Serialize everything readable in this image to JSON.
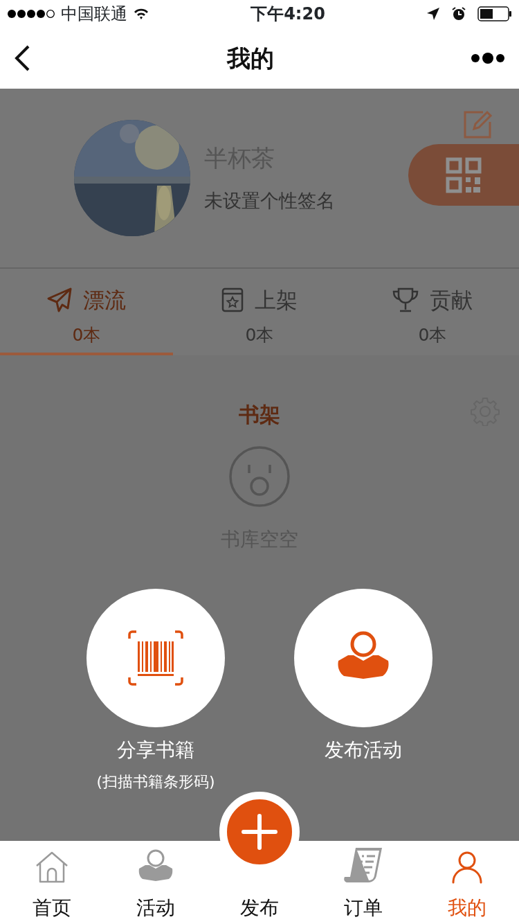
{
  "status_bar": {
    "carrier": "中国联通",
    "time": "下午4:20"
  },
  "nav": {
    "title": "我的"
  },
  "profile": {
    "name": "半杯茶",
    "signature": "未设置个性签名"
  },
  "stat_tabs": [
    {
      "kind": "plane",
      "label": "漂流",
      "count": "0本",
      "selected": true
    },
    {
      "kind": "shelf",
      "label": "上架",
      "count": "0本",
      "selected": false
    },
    {
      "kind": "trophy",
      "label": "贡献",
      "count": "0本",
      "selected": false
    }
  ],
  "shelf": {
    "title": "书架",
    "empty_text": "书库空空"
  },
  "actions": [
    {
      "kind": "scan",
      "label": "分享书籍",
      "sublabel": "(扫描书籍条形码)"
    },
    {
      "kind": "activity",
      "label": "发布活动"
    }
  ],
  "tab_bar": [
    {
      "kind": "home",
      "label": "首页",
      "selected": false
    },
    {
      "kind": "activity",
      "label": "活动",
      "selected": false
    },
    {
      "kind": "publish",
      "label": "发布",
      "selected": false
    },
    {
      "kind": "orders",
      "label": "订单",
      "selected": false
    },
    {
      "kind": "profile",
      "label": "我的",
      "selected": true
    }
  ]
}
